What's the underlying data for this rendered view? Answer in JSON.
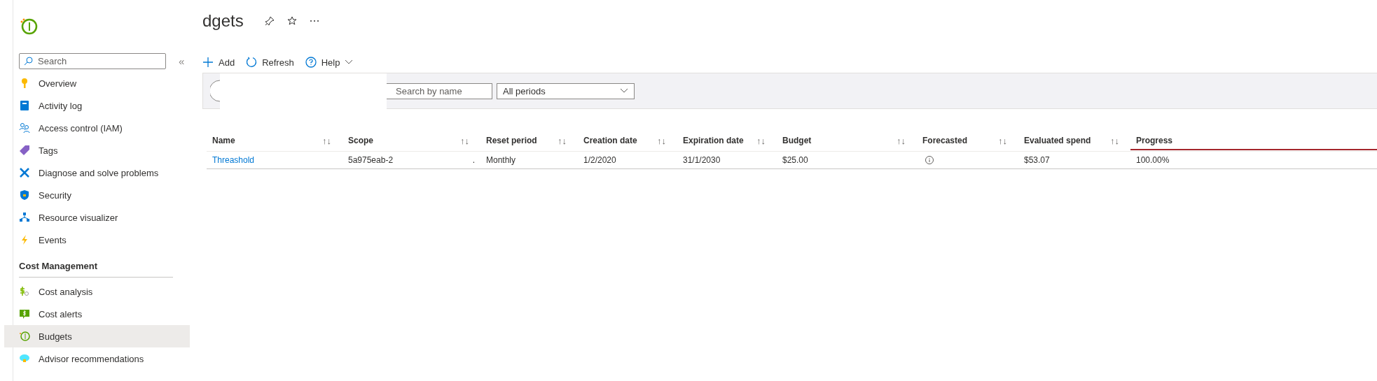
{
  "sidebar": {
    "search": {
      "placeholder": "Search"
    },
    "collapse": "«",
    "items": [
      {
        "label": "Overview",
        "selected": false
      },
      {
        "label": "Activity log",
        "selected": false
      },
      {
        "label": "Access control (IAM)",
        "selected": false
      },
      {
        "label": "Tags",
        "selected": false
      },
      {
        "label": "Diagnose and solve problems",
        "selected": false
      },
      {
        "label": "Security",
        "selected": false
      },
      {
        "label": "Resource visualizer",
        "selected": false
      },
      {
        "label": "Events",
        "selected": false
      }
    ],
    "section": {
      "title": "Cost Management",
      "items": [
        {
          "label": "Cost analysis",
          "selected": false
        },
        {
          "label": "Cost alerts",
          "selected": false
        },
        {
          "label": "Budgets",
          "selected": true
        },
        {
          "label": "Advisor recommendations",
          "selected": false
        }
      ]
    }
  },
  "title": "dgets",
  "toolbar": [
    {
      "label": "Add"
    },
    {
      "label": "Refresh"
    },
    {
      "label": "Help"
    }
  ],
  "filters": {
    "search": {
      "placeholder": "Search by name"
    },
    "period": "All periods"
  },
  "table": {
    "columns": [
      {
        "label": "Name",
        "sort": "↑↓"
      },
      {
        "label": "Scope",
        "sort": "↑↓"
      },
      {
        "label": "Reset period",
        "sort": "↑↓"
      },
      {
        "label": "Creation date",
        "sort": "↑↓"
      },
      {
        "label": "Expiration date",
        "sort": "↑↓"
      },
      {
        "label": "Budget",
        "sort": "↑↓"
      },
      {
        "label": "Forecasted",
        "sort": "↑↓"
      },
      {
        "label": "Evaluated spend",
        "sort": "↑↓"
      },
      {
        "label": "Progress"
      }
    ],
    "rows": [
      {
        "name": "Threashold",
        "scope": "5a975eab-2",
        "scope_tail": ".",
        "reset_period": "Monthly",
        "creation_date": "1/2/2020",
        "expiration_date": "31/1/2030",
        "budget": "$25.00",
        "evaluated_spend": "$53.07",
        "progress": "100.00%",
        "level": 1
      }
    ]
  }
}
